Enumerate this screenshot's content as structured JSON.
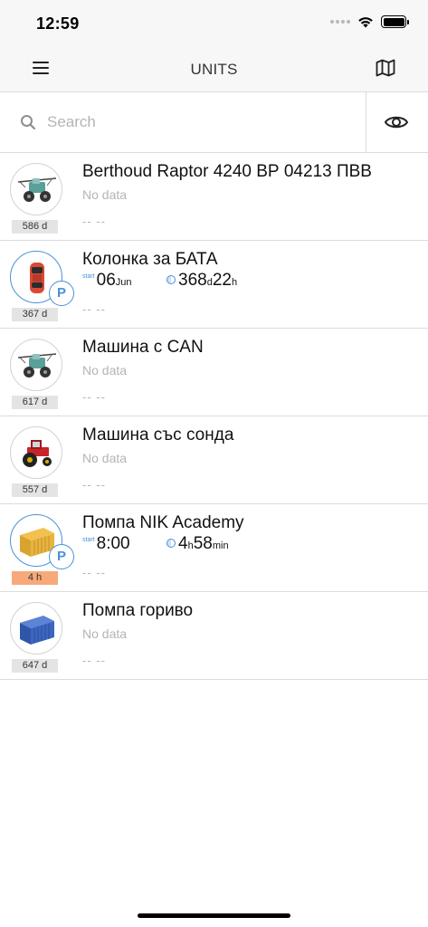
{
  "status_bar": {
    "time": "12:59"
  },
  "nav": {
    "title": "UNITS",
    "menu_icon": "hamburger-menu-icon",
    "map_icon": "map-icon"
  },
  "search": {
    "placeholder": "Search",
    "value": "",
    "visibility_icon": "eye-icon"
  },
  "units": [
    {
      "name": "Berthoud Raptor 4240 ВР 04213 ПВВ",
      "status": "No data",
      "last": "-- --",
      "age": "586 d",
      "icon": "sprayer-icon",
      "parked": false,
      "warn": false
    },
    {
      "name": "Колонка за БАТА",
      "status": "",
      "last": "-- --",
      "age": "367 d",
      "icon": "car-icon",
      "parked": true,
      "warn": false,
      "trip": {
        "start_label": "start",
        "start_big": "06",
        "start_small": "Jun",
        "dur1_big": "368",
        "dur1_small": "d",
        "dur2_big": "22",
        "dur2_small": "h"
      }
    },
    {
      "name": "Машина с CAN",
      "status": "No data",
      "last": "-- --",
      "age": "617 d",
      "icon": "sprayer-icon",
      "parked": false,
      "warn": false
    },
    {
      "name": "Машина със сонда",
      "status": "No data",
      "last": "-- --",
      "age": "557 d",
      "icon": "tractor-icon",
      "parked": false,
      "warn": false
    },
    {
      "name": "Помпа NIK Academy",
      "status": "",
      "last": "-- --",
      "age": "4 h",
      "icon": "container-yellow-icon",
      "parked": true,
      "warn": true,
      "trip": {
        "start_label": "start",
        "start_big": "8:00",
        "start_small": "",
        "dur1_big": "4",
        "dur1_small": "h",
        "dur2_big": "58",
        "dur2_small": "min"
      }
    },
    {
      "name": "Помпа гориво",
      "status": "No data",
      "last": "-- --",
      "age": "647 d",
      "icon": "container-blue-icon",
      "parked": false,
      "warn": false
    }
  ],
  "colors": {
    "accent": "#4a90d9",
    "warn_badge": "#f7a97a",
    "muted_text": "#b4b4b4",
    "divider": "#dcdcdc"
  }
}
